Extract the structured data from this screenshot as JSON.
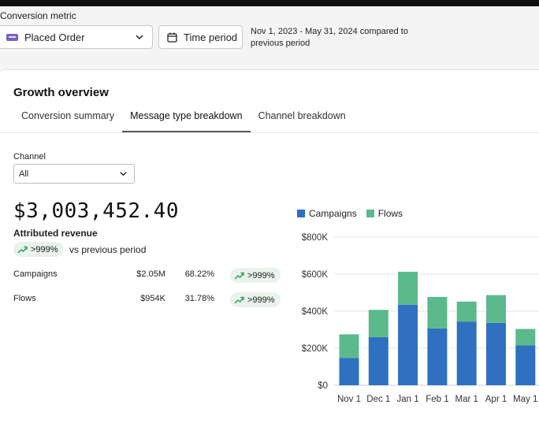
{
  "header": {
    "conversion_metric_label": "Conversion metric",
    "metric_value": "Placed Order",
    "time_period_label": "Time period",
    "date_range_line1": "Nov 1, 2023 - May 31, 2024 compared to",
    "date_range_line2": "previous period"
  },
  "card": {
    "title": "Growth overview",
    "tabs": [
      {
        "label": "Conversion summary"
      },
      {
        "label": "Message type breakdown"
      },
      {
        "label": "Channel breakdown"
      }
    ],
    "active_tab": "Message type breakdown",
    "channel_label": "Channel",
    "channel_value": "All",
    "total_revenue": "$3,003,452.40",
    "total_revenue_label": "Attributed revenue",
    "total_change": ">999%",
    "vs_text": "vs previous period",
    "rows": [
      {
        "name": "Campaigns",
        "amount": "$2.05M",
        "share": "68.22%",
        "change": ">999%"
      },
      {
        "name": "Flows",
        "amount": "$954K",
        "share": "31.78%",
        "change": ">999%"
      }
    ]
  },
  "colors": {
    "campaigns": "#2f70c0",
    "flows": "#5bb98c",
    "badge_bg": "#e8f3ec",
    "trend_arrow": "#2a9d5c"
  },
  "chart_data": {
    "type": "bar",
    "stacked": true,
    "categories": [
      "Nov 1",
      "Dec 1",
      "Jan 1",
      "Feb 1",
      "Mar 1",
      "Apr 1",
      "May 1"
    ],
    "series": [
      {
        "name": "Campaigns",
        "color": "#2f70c0",
        "values": [
          148000,
          260000,
          435000,
          307000,
          344000,
          337000,
          215000
        ]
      },
      {
        "name": "Flows",
        "color": "#5bb98c",
        "values": [
          127000,
          147000,
          178000,
          170000,
          108000,
          150000,
          89000
        ]
      }
    ],
    "yticks": [
      0,
      200000,
      400000,
      600000,
      800000
    ],
    "ytick_labels": [
      "$0",
      "$200K",
      "$400K",
      "$600K",
      "$800K"
    ],
    "ylim": [
      0,
      800000
    ],
    "legend": "top-left",
    "grid": true
  }
}
